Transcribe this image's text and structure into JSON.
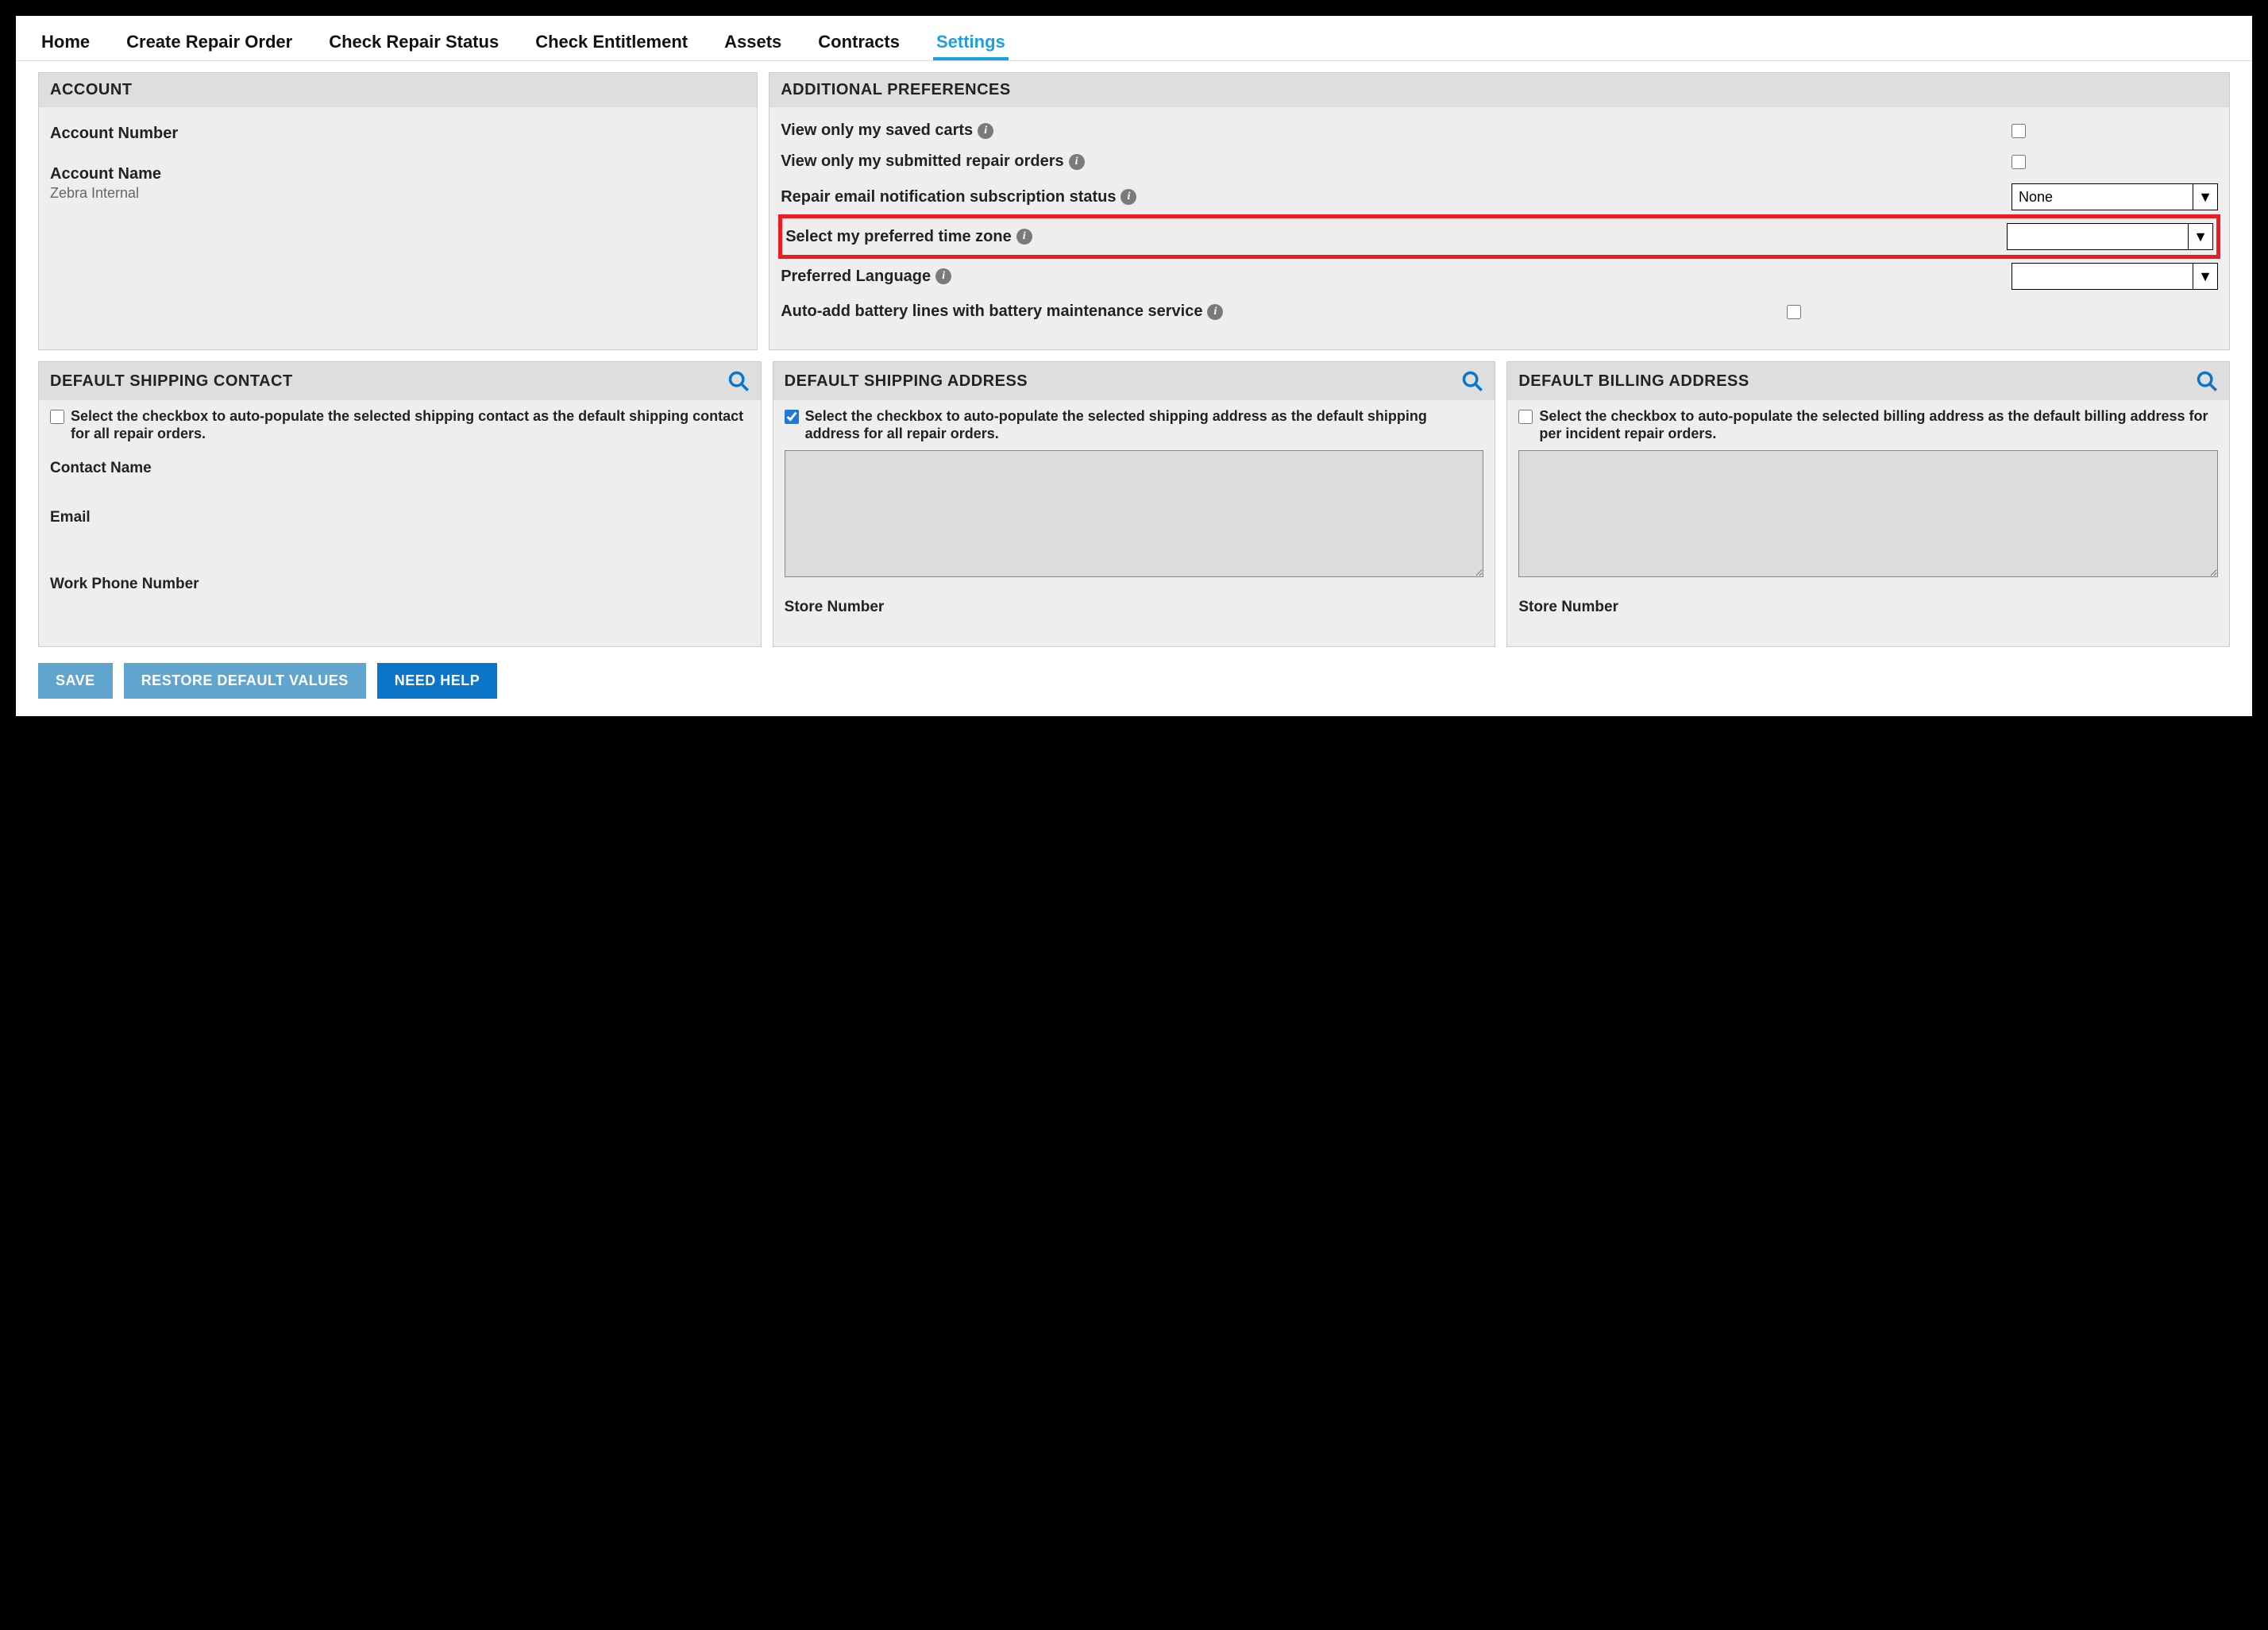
{
  "nav": {
    "items": [
      {
        "label": "Home"
      },
      {
        "label": "Create Repair Order"
      },
      {
        "label": "Check Repair Status"
      },
      {
        "label": "Check Entitlement"
      },
      {
        "label": "Assets"
      },
      {
        "label": "Contracts"
      },
      {
        "label": "Settings",
        "active": true
      }
    ]
  },
  "account": {
    "title": "ACCOUNT",
    "number_label": "Account Number",
    "number_value": "",
    "name_label": "Account Name",
    "name_value": "Zebra Internal"
  },
  "prefs": {
    "title": "ADDITIONAL PREFERENCES",
    "saved_carts_label": "View only my saved carts",
    "saved_carts_checked": false,
    "submitted_label": "View only my submitted repair orders",
    "submitted_checked": false,
    "repair_email_label": "Repair email notification subscription status",
    "repair_email_value": "None",
    "timezone_label": "Select my preferred time zone",
    "timezone_value": "",
    "language_label": "Preferred Language",
    "language_value": "",
    "battery_label": "Auto-add battery lines with battery maintenance service",
    "battery_checked": false
  },
  "ship_contact": {
    "title": "DEFAULT SHIPPING CONTACT",
    "chk_text": "Select the checkbox to auto-populate the selected shipping contact as the default shipping contact for all repair orders.",
    "chk_checked": false,
    "contact_name_label": "Contact Name",
    "email_label": "Email",
    "phone_label": "Work Phone Number"
  },
  "ship_addr": {
    "title": "DEFAULT SHIPPING ADDRESS",
    "chk_text": "Select the checkbox to auto-populate the selected shipping address as the default shipping address for all repair orders.",
    "chk_checked": true,
    "address_value": "",
    "store_label": "Store Number"
  },
  "bill_addr": {
    "title": "DEFAULT BILLING ADDRESS",
    "chk_text": "Select the checkbox to auto-populate the selected billing address as the default billing address for per incident repair orders.",
    "chk_checked": false,
    "address_value": "",
    "store_label": "Store Number"
  },
  "buttons": {
    "save": "SAVE",
    "restore": "RESTORE DEFAULT VALUES",
    "help": "NEED HELP"
  }
}
